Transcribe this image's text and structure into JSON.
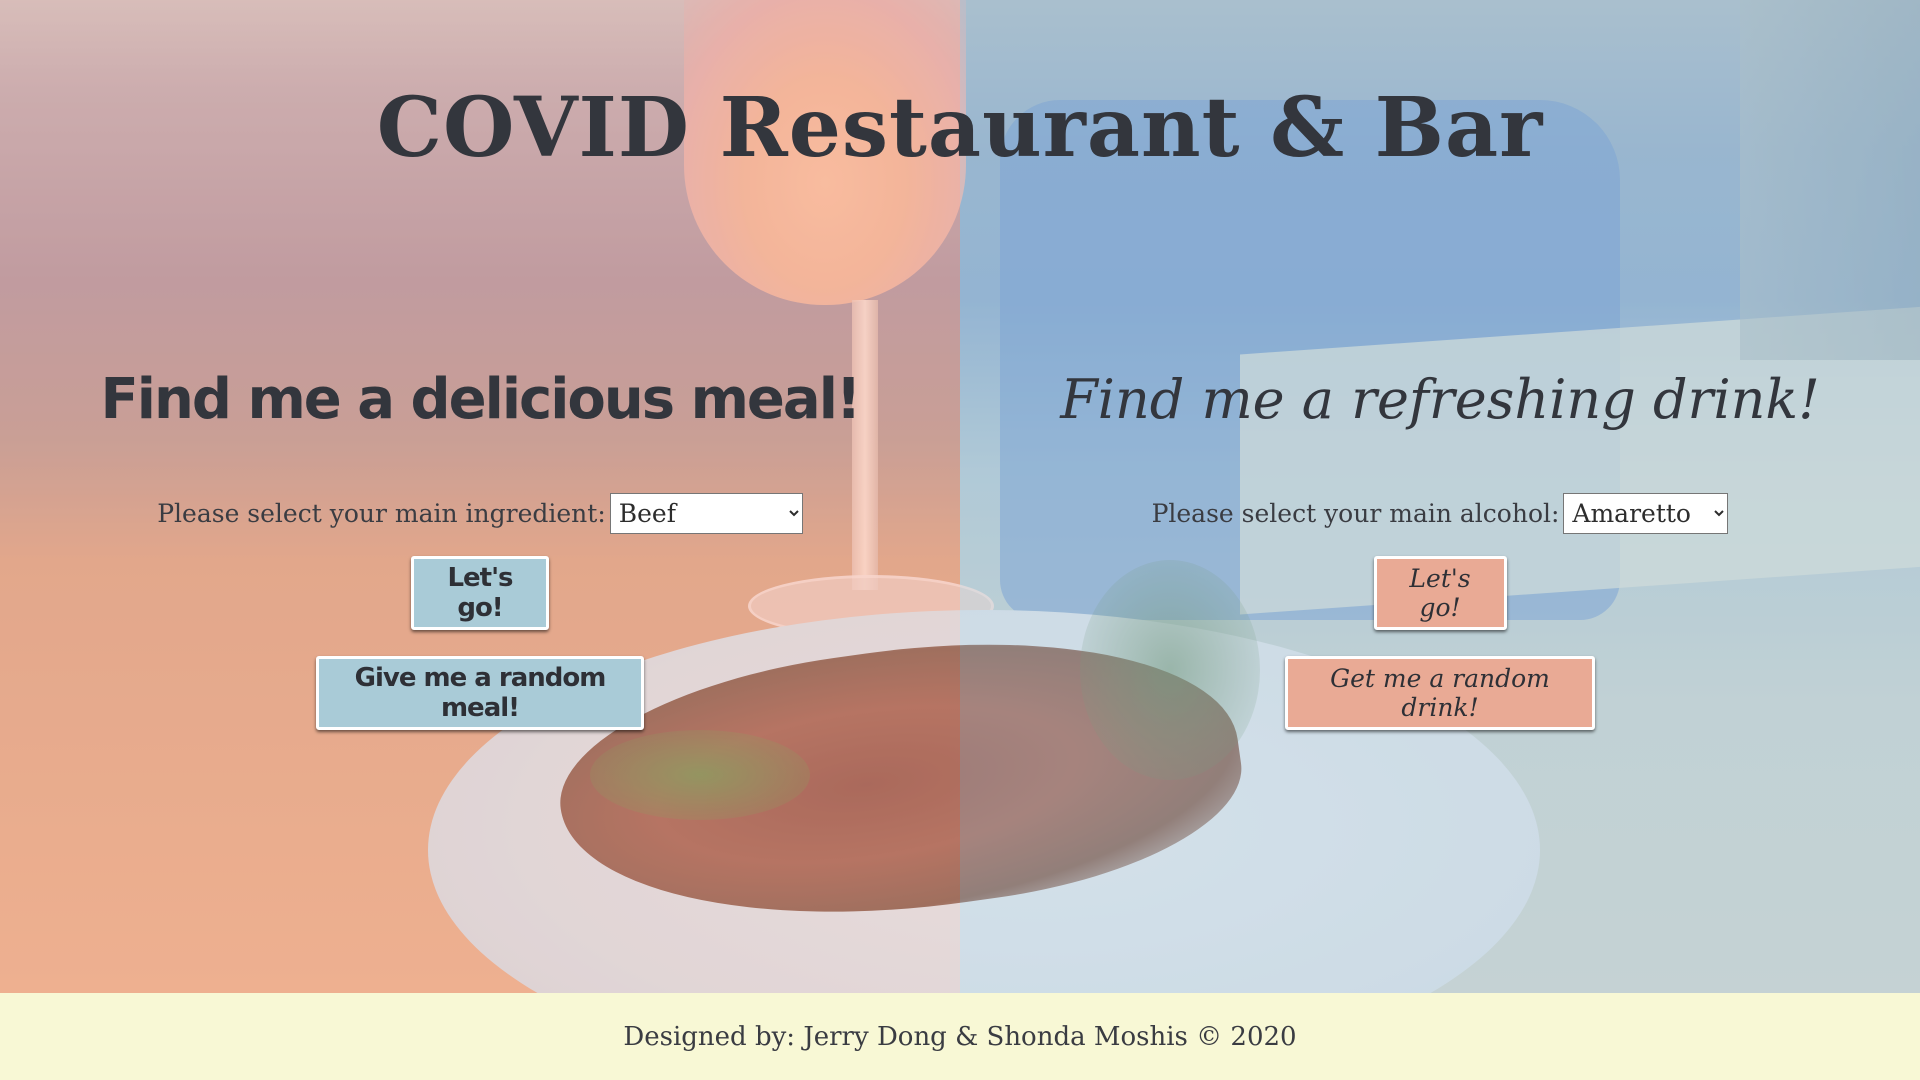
{
  "header": {
    "title": "COVID Restaurant & Bar"
  },
  "meal": {
    "heading": "Find me a delicious meal!",
    "select_label": "Please select your main ingredient:",
    "selected_ingredient": "Beef",
    "go_button": "Let's go!",
    "random_button": "Give me a random meal!",
    "button_color": "#a9cbd7"
  },
  "drink": {
    "heading": "Find me a refreshing drink!",
    "select_label": "Please select your main alcohol:",
    "selected_alcohol": "Amaretto",
    "go_button": "Let's go!",
    "random_button": "Get me a random drink!",
    "button_color": "#e9aa95"
  },
  "footer": {
    "credit": "Designed by: Jerry Dong & Shonda Moshis © 2020",
    "background_color": "#f8f8d5"
  },
  "icons": {
    "select_arrow": "chevron-down-icon"
  }
}
